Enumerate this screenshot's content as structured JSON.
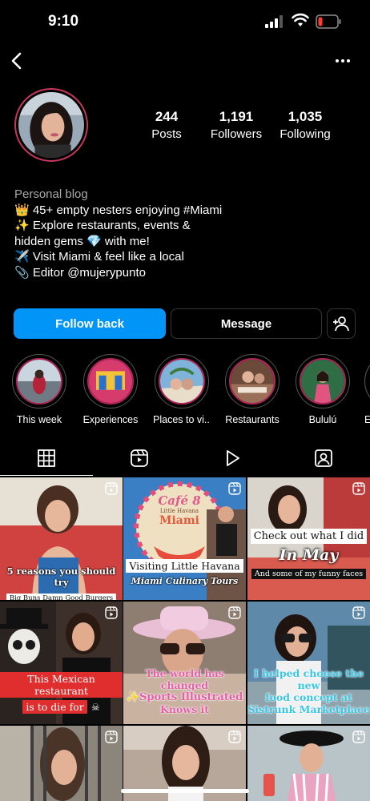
{
  "status": {
    "time": "9:10"
  },
  "profile": {
    "stats": [
      {
        "value": "244",
        "label": "Posts"
      },
      {
        "value": "1,191",
        "label": "Followers"
      },
      {
        "value": "1,035",
        "label": "Following"
      }
    ],
    "category": "Personal blog",
    "bio": [
      "👑 45+ empty nesters enjoying #Miami",
      "✨ Explore restaurants, events &",
      "hidden gems 💎 with me!",
      "✈️ Visit Miami & feel like a local",
      "📎 Editor @mujerypunto"
    ]
  },
  "actions": {
    "follow_label": "Follow back",
    "message_label": "Message"
  },
  "highlights": [
    {
      "label": "This week"
    },
    {
      "label": "Experiences"
    },
    {
      "label": "Places to vi..."
    },
    {
      "label": "Restaurants"
    },
    {
      "label": "Bululú"
    },
    {
      "label": "E"
    }
  ],
  "tabs": [
    "grid-icon",
    "reels-icon",
    "play-icon",
    "tagged-icon"
  ],
  "posts": [
    {
      "caption1": "5 reasons you should try",
      "caption2": "Big Buns Damn Good Burgers"
    },
    {
      "sign1": "Café 8",
      "sign2": "Little Havana",
      "sign3": "Miami",
      "caption1": "Visiting Little Havana",
      "caption2": "Miami Culinary Tours"
    },
    {
      "caption1": "Check out what I did",
      "caption2": "In May",
      "caption3": "And some of my funny faces"
    },
    {
      "caption1": "This Mexican restaurant",
      "caption2": "is to die for"
    },
    {
      "caption1": "The world has changed",
      "caption2": "Sports Illustrated",
      "caption3": "Knows it"
    },
    {
      "caption1": "I helped choose the new",
      "caption2": "food concept at",
      "caption3": "Sistrunk Marketplace"
    },
    {},
    {},
    {}
  ],
  "colors": {
    "accent": "#0095f6",
    "ring": "#c7365d",
    "pink": "#e53f8a"
  }
}
